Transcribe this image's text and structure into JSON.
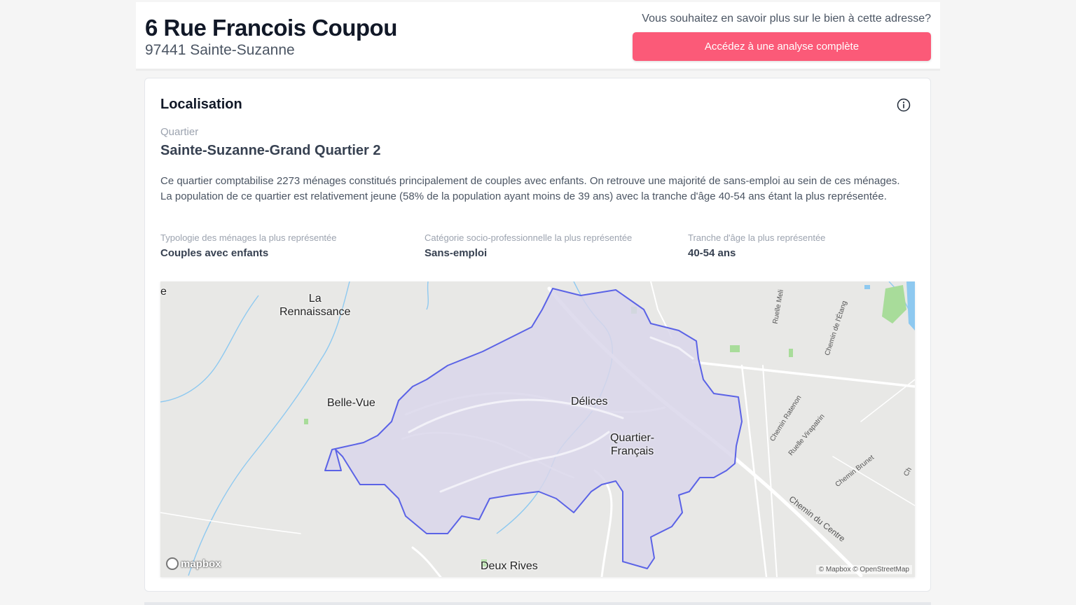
{
  "header": {
    "title": "6 Rue Francois Coupou",
    "subtitle": "97441 Sainte-Suzanne",
    "cta_question": "Vous souhaitez en savoir plus sur le bien à cette adresse?",
    "cta_button": "Accédez à une analyse complète",
    "accent_color": "#fb5a78"
  },
  "localisation": {
    "title": "Localisation",
    "quartier_label": "Quartier",
    "quartier_name": "Sainte-Suzanne-Grand Quartier 2",
    "description": "Ce quartier comptabilise 2273 ménages constitués principalement de couples avec enfants. On retrouve une majorité de sans-emploi au sein de ces ménages. La population de ce quartier est relativement jeune (58% de la population ayant moins de 39 ans) avec la tranche d'âge 40-54 ans étant la plus représentée.",
    "stats": [
      {
        "label": "Typologie des ménages la plus représentée",
        "value": "Couples avec enfants"
      },
      {
        "label": "Catégorie socio-professionnelle la plus représentée",
        "value": "Sans-emploi"
      },
      {
        "label": "Tranche d'âge la plus représentée",
        "value": "40-54 ans"
      }
    ]
  },
  "map": {
    "places": {
      "renaissance": "La\nRennaissance",
      "belle_vue": "Belle-Vue",
      "delices": "Délices",
      "quartier_francais": "Quartier-\nFrançais",
      "deux_rives": "Deux Rives",
      "edge": "e"
    },
    "streets": {
      "ruelle_meli": "Ruelle Meli",
      "chemin_etang": "Chemin de l'Étang",
      "chemin_ratenon": "Chemin Ratenon",
      "ruelle_virapatrin": "Ruelle Virapatrin",
      "chemin_brunet": "Chemin Brunet",
      "chemin_centre": "Chemin du Centre",
      "edge_ch": "Ch"
    },
    "logo": "mapbox",
    "attribution": "© Mapbox © OpenStreetMap",
    "polygon_fill": "#d9d6ea",
    "polygon_stroke": "#5b63e6"
  }
}
